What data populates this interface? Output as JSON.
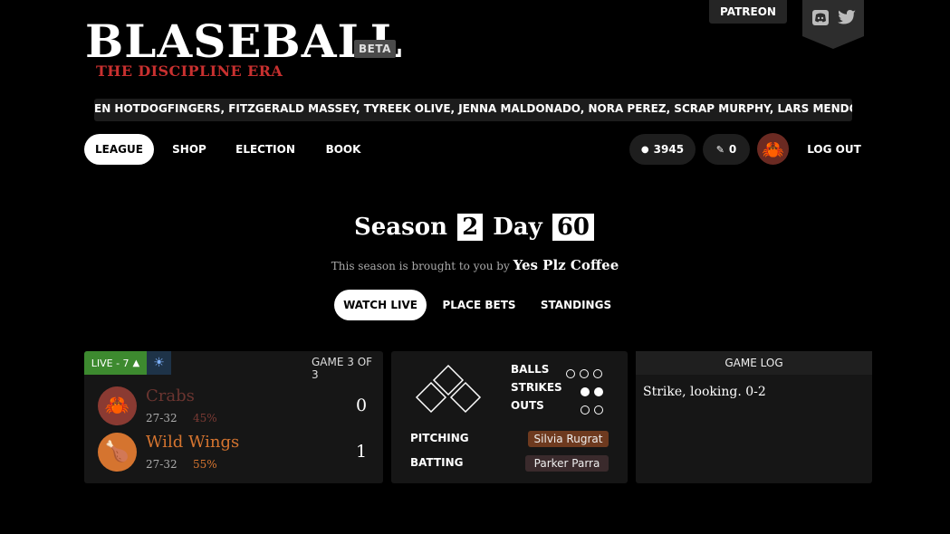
{
  "header": {
    "title": "BLASEBALL",
    "beta_badge": "BETA",
    "era": "THE DISCIPLINE ERA",
    "patreon_label": "PATREON"
  },
  "ticker": {
    "text": "EN HOTDOGFINGERS, FITZGERALD MASSEY, TYREEK OLIVE, JENNA MALDONADO, NORA PEREZ, SCRAP MURPHY, LARS MENDOZA"
  },
  "nav": {
    "items": [
      {
        "label": "LEAGUE"
      },
      {
        "label": "SHOP"
      },
      {
        "label": "ELECTION"
      },
      {
        "label": "BOOK"
      }
    ],
    "coins": "3945",
    "votes": "0",
    "logout": "LOG OUT"
  },
  "season": {
    "season_label": "Season",
    "season_number": "2",
    "day_label": "Day",
    "day_number": "60",
    "sponsor_prefix": "This season is brought to you by",
    "sponsor_name": "Yes Plz Coffee"
  },
  "tabs": [
    {
      "label": "WATCH LIVE"
    },
    {
      "label": "PLACE BETS"
    },
    {
      "label": "STANDINGS"
    }
  ],
  "game": {
    "live_label": "LIVE - 7",
    "game_of": "GAME 3 OF 3",
    "away": {
      "name": "Crabs",
      "record": "27-32",
      "odds": "45%",
      "score": "0",
      "color": "#8a3a32",
      "icon": "crab-icon"
    },
    "home": {
      "name": "Wild Wings",
      "record": "27-32",
      "odds": "55%",
      "score": "1",
      "color": "#d5742f",
      "icon": "chicken-leg-icon"
    },
    "balls_label": "BALLS",
    "strikes_label": "STRIKES",
    "outs_label": "OUTS",
    "balls": 0,
    "strikes": 2,
    "outs": 0,
    "pitching_label": "PITCHING",
    "pitcher": "Silvia Rugrat",
    "batting_label": "BATTING",
    "batter": "Parker Parra",
    "log_title": "GAME LOG",
    "log_text": "Strike, looking. 0-2"
  }
}
